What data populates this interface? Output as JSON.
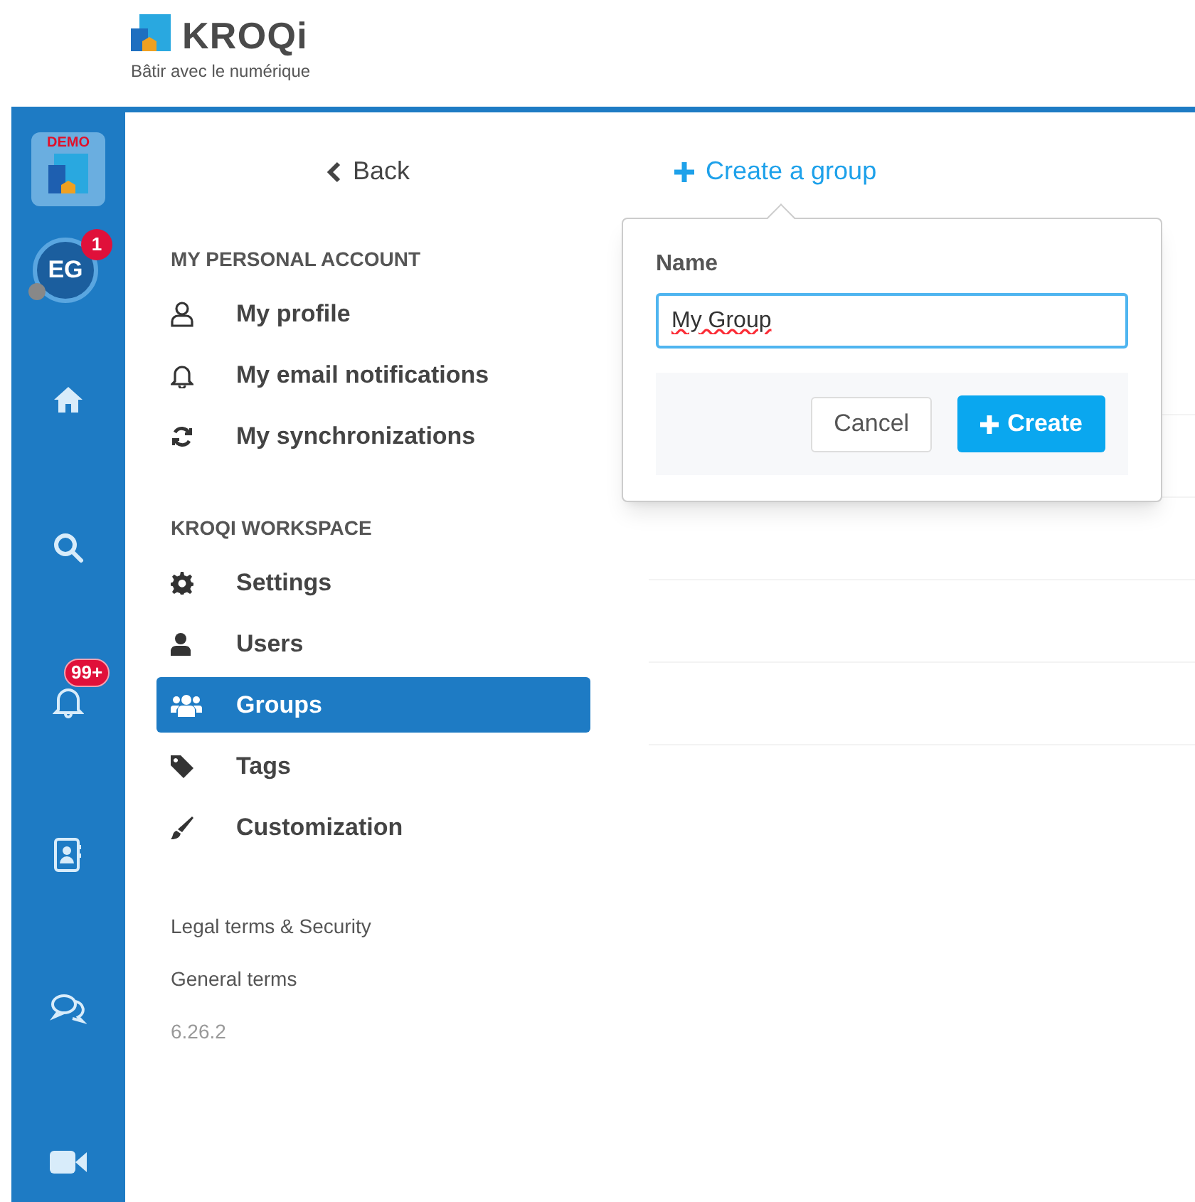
{
  "header": {
    "logo": "KROQi",
    "tagline": "Bâtir avec le numérique"
  },
  "rail": {
    "demo_badge": "DEMO",
    "avatar": {
      "initials": "EG",
      "badge": "1"
    },
    "items": [
      {
        "kind": "home"
      },
      {
        "kind": "search"
      },
      {
        "kind": "bell",
        "badge": "99+"
      },
      {
        "kind": "contacts"
      },
      {
        "kind": "chat"
      },
      {
        "kind": "video"
      }
    ]
  },
  "nav": {
    "back": "Back",
    "sections": [
      {
        "title": "MY PERSONAL ACCOUNT",
        "items": [
          {
            "kind": "user-outline",
            "label": "My profile",
            "selected": false
          },
          {
            "kind": "bell",
            "label": "My email notifications",
            "selected": false
          },
          {
            "kind": "sync",
            "label": "My synchronizations",
            "selected": false
          }
        ]
      },
      {
        "title": "KROQI WORKSPACE",
        "items": [
          {
            "kind": "gear",
            "label": "Settings",
            "selected": false
          },
          {
            "kind": "user",
            "label": "Users",
            "selected": false
          },
          {
            "kind": "users",
            "label": "Groups",
            "selected": true
          },
          {
            "kind": "tag",
            "label": "Tags",
            "selected": false
          },
          {
            "kind": "brush",
            "label": "Customization",
            "selected": false
          }
        ]
      }
    ],
    "links": [
      "Legal terms & Security",
      "General terms"
    ],
    "version": "6.26.2"
  },
  "toolbar": {
    "create_group": "Create a group"
  },
  "popover": {
    "label": "Name",
    "value": "My Group",
    "cancel": "Cancel",
    "create": "Create"
  }
}
